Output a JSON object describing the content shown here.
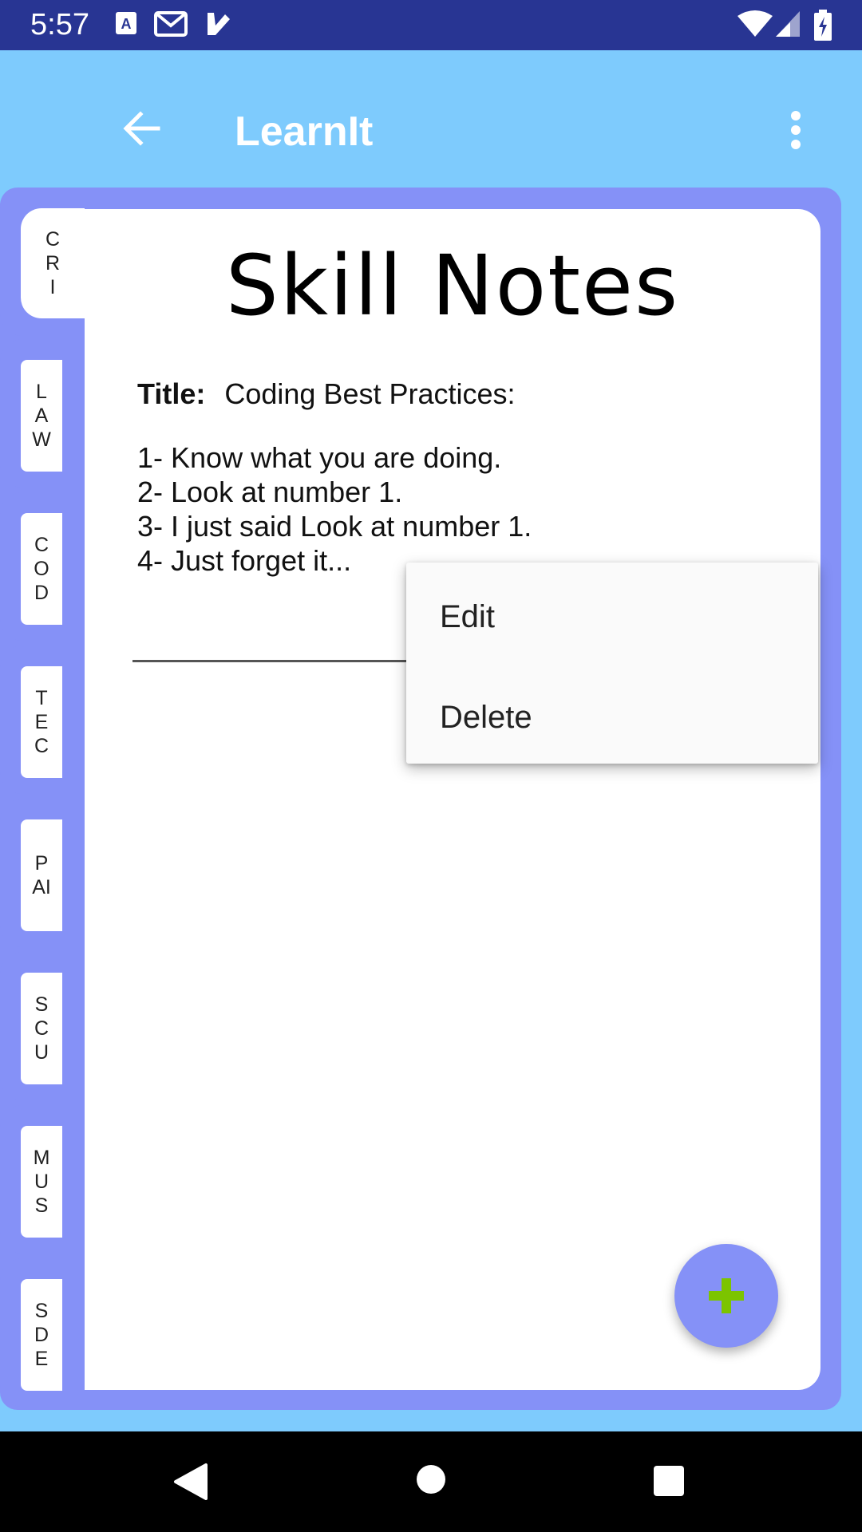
{
  "status_bar": {
    "time": "5:57",
    "left_icons": [
      "text-a-icon",
      "gmail-icon",
      "checkmark-icon"
    ],
    "right_icons": [
      "wifi-icon",
      "signal-icon",
      "battery-icon"
    ]
  },
  "app_bar": {
    "title": "LearnIt",
    "back_icon": "arrow-back-icon",
    "menu_icon": "overflow-menu-icon"
  },
  "tabs": [
    {
      "label": "CRI",
      "active": true
    },
    {
      "label": "LAW",
      "active": false
    },
    {
      "label": "COD",
      "active": false
    },
    {
      "label": "TEC",
      "active": false
    },
    {
      "label": "PAI",
      "active": false
    },
    {
      "label": "SCU",
      "active": false
    },
    {
      "label": "MUS",
      "active": false
    },
    {
      "label": "SDE",
      "active": false
    }
  ],
  "card": {
    "heading": "Skill Notes",
    "title_label": "Title:",
    "title_value": "Coding Best Practices:",
    "lines": [
      "1- Know what you are doing.",
      "2- Look at number 1.",
      "3- I just said Look at number 1.",
      "4- Just forget it..."
    ]
  },
  "popup_menu": {
    "items": [
      "Edit",
      "Delete"
    ]
  },
  "fab": {
    "icon": "plus-icon"
  },
  "nav_bar": {
    "icons": [
      "back-triangle-icon",
      "home-circle-icon",
      "recents-square-icon"
    ]
  },
  "colors": {
    "status_bar": "#283593",
    "app_bar": "#7ecbfd",
    "frame": "#8591f7",
    "fab_plus": "#7cc400"
  }
}
